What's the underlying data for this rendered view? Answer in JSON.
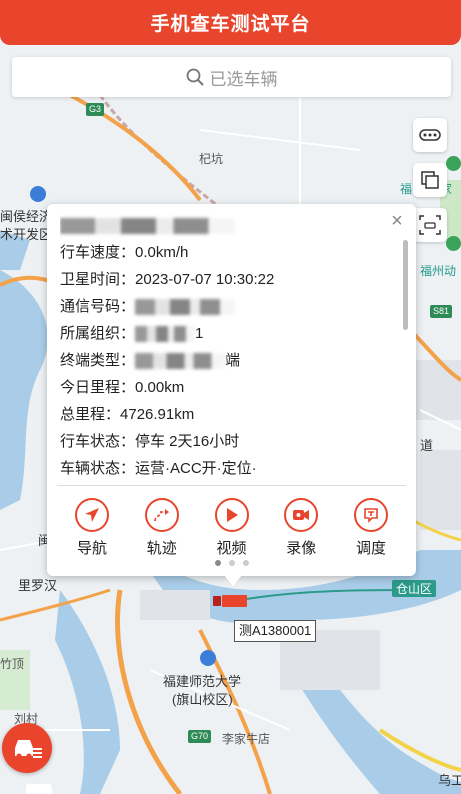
{
  "header": {
    "title": "手机查车测试平台"
  },
  "search": {
    "placeholder": "已选车辆"
  },
  "map": {
    "labels": {
      "pikeng": "杞坑",
      "minhou": "闽侯经济",
      "jishu": "术开发区",
      "fuzhou_dong": "福州动",
      "fu": "福",
      "jia": "家",
      "dao": "道",
      "min": "闽",
      "liluohan": "里罗汉",
      "cangshan": "仓山区",
      "zhuding": "竹顶",
      "normal_univ": "福建师范大学",
      "campus": "(旗山校区)",
      "liucun": "刘村",
      "lijianiudian": "李家牛店",
      "wugong": "乌工"
    },
    "roads": {
      "g3": "G3",
      "s81": "S81",
      "g70": "G70"
    }
  },
  "popup": {
    "rows": [
      {
        "label": "行车速度：",
        "value": "0.0km/h"
      },
      {
        "label": "卫星时间：",
        "value": "2023-07-07 10:30:22"
      },
      {
        "label": "通信号码：",
        "value": ""
      },
      {
        "label": "所属组织：",
        "value": "1"
      },
      {
        "label": "终端类型：",
        "value": "端"
      },
      {
        "label": "今日里程：",
        "value": "0.00km"
      },
      {
        "label": "总里程：",
        "value": "4726.91km"
      },
      {
        "label": "行车状态：",
        "value": "停车 2天16小时"
      },
      {
        "label": "车辆状态：",
        "value": "运营·ACC开·定位·"
      }
    ],
    "actions": [
      {
        "label": "导航",
        "icon": "navigation-icon"
      },
      {
        "label": "轨迹",
        "icon": "track-icon"
      },
      {
        "label": "视频",
        "icon": "video-play-icon"
      },
      {
        "label": "录像",
        "icon": "recording-icon"
      },
      {
        "label": "调度",
        "icon": "dispatch-icon"
      }
    ],
    "close_label": "×"
  },
  "vehicle": {
    "plate": "测A1380001"
  },
  "colors": {
    "accent": "#e8452c",
    "road": "#f3a24a",
    "water": "#a9cde8",
    "park": "#cde8c7"
  }
}
